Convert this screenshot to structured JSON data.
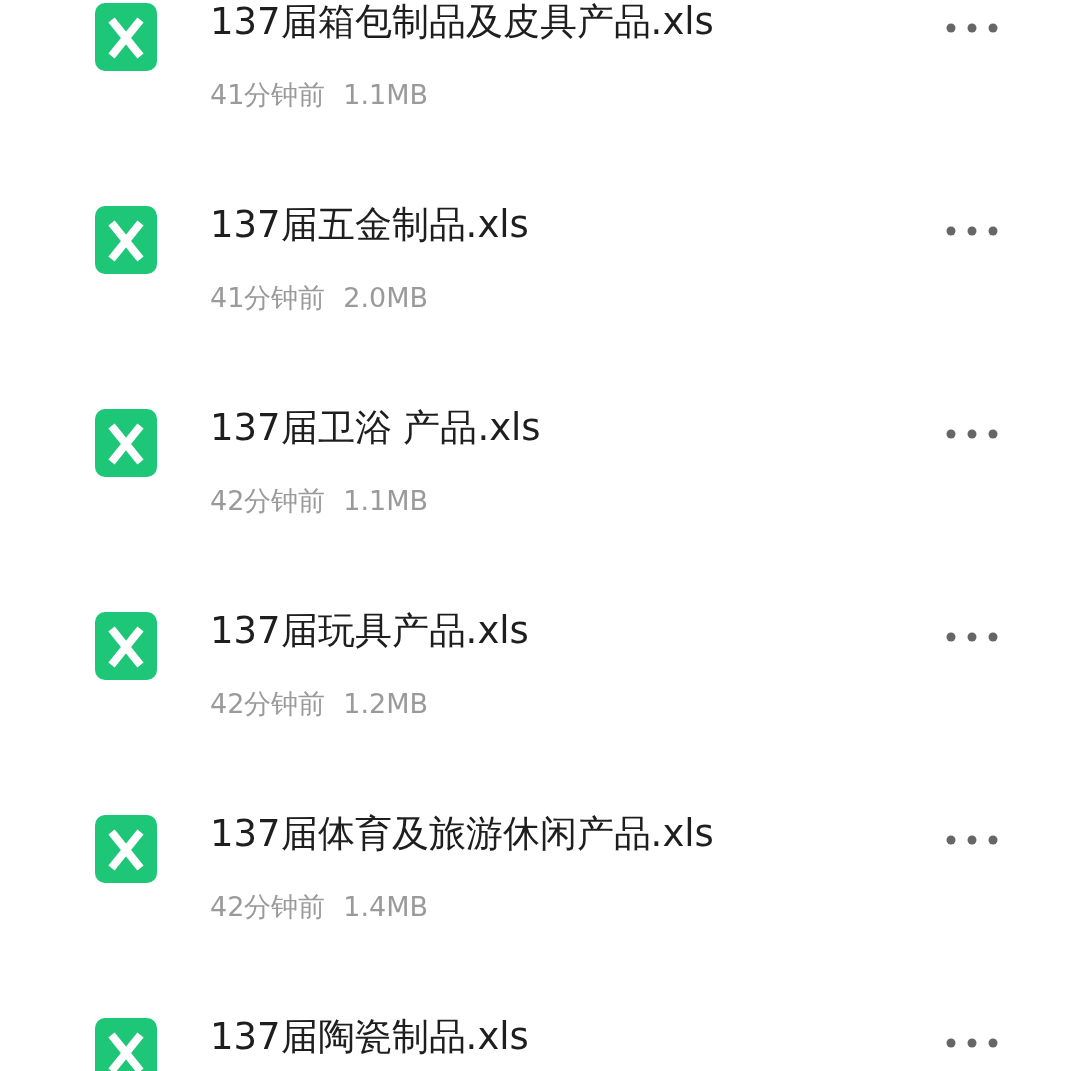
{
  "files": [
    {
      "name": "137届箱包制品及皮具产品.xls",
      "time": "41分钟前",
      "size": "1.1MB"
    },
    {
      "name": "137届五金制品.xls",
      "time": "41分钟前",
      "size": "2.0MB"
    },
    {
      "name": "137届卫浴 产品.xls",
      "time": "42分钟前",
      "size": "1.1MB"
    },
    {
      "name": "137届玩具产品.xls",
      "time": "42分钟前",
      "size": "1.2MB"
    },
    {
      "name": "137届体育及旅游休闲产品.xls",
      "time": "42分钟前",
      "size": "1.4MB"
    },
    {
      "name": "137届陶瓷制品.xls"
    }
  ]
}
